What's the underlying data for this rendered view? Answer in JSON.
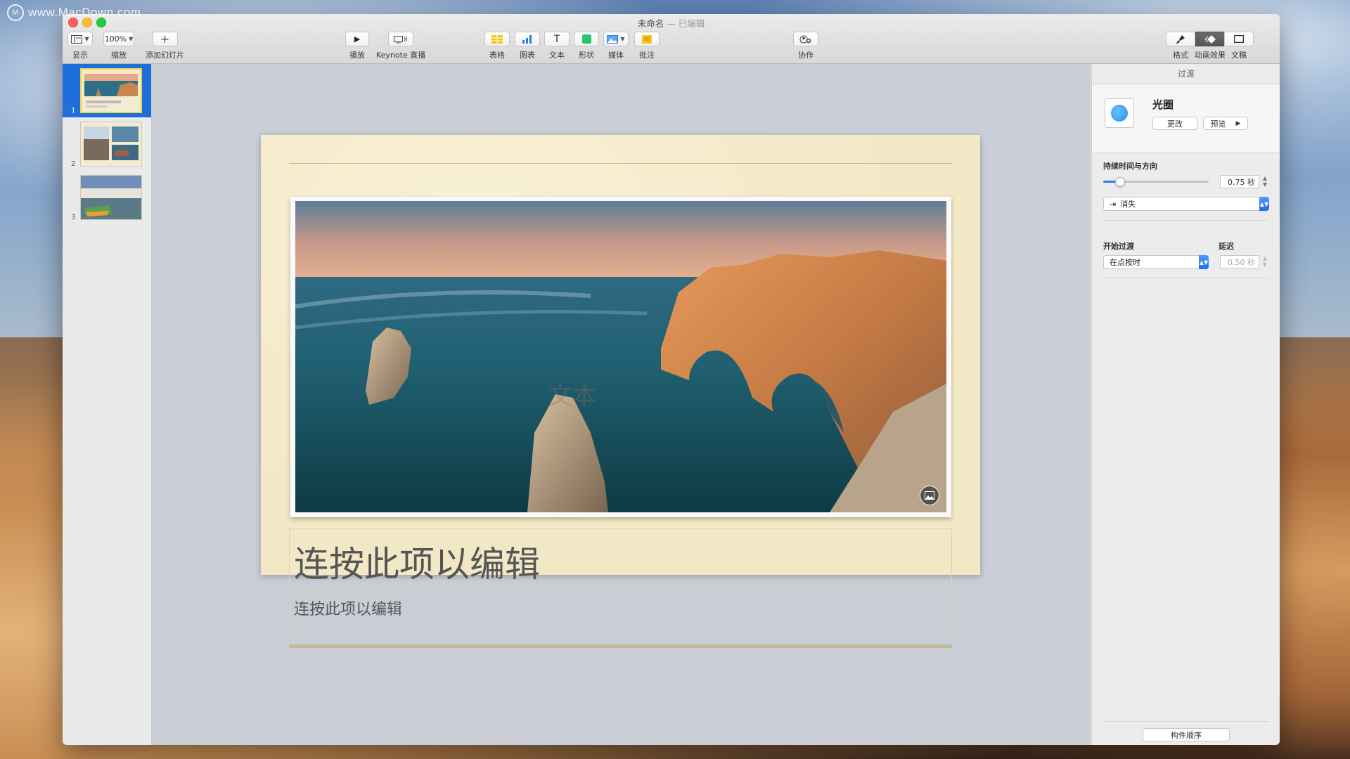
{
  "desktop": {
    "watermark": "www.MacDown.com",
    "watermark_logo": "M"
  },
  "window": {
    "doc_title": "未命名",
    "doc_status": "— 已编辑"
  },
  "toolbar": {
    "view_label": "显示",
    "zoom_value": "100%",
    "zoom_label": "缩放",
    "add_slide_label": "添加幻灯片",
    "play_label": "播放",
    "keynote_live_label": "Keynote 直播",
    "table_label": "表格",
    "chart_label": "图表",
    "text_label": "文本",
    "shape_label": "形状",
    "media_label": "媒体",
    "comment_label": "批注",
    "collaborate_label": "协作",
    "format_label": "格式",
    "animate_label": "动画效果",
    "document_label": "文稿"
  },
  "slides": [
    {
      "number": "1"
    },
    {
      "number": "2"
    },
    {
      "number": "3"
    }
  ],
  "slide": {
    "ghost_text": "文本",
    "title": "连按此项以编辑",
    "subtitle": "连按此项以编辑"
  },
  "inspector": {
    "header": "过渡",
    "transition_name": "光圈",
    "change_button": "更改",
    "preview_button": "预览",
    "duration_section": "持续时间与方向",
    "duration_value": "0.75 秒",
    "duration_fraction": 0.15,
    "direction_value": "消失",
    "start_section": "开始过渡",
    "start_value": "在点按时",
    "delay_section": "延迟",
    "delay_value": "0.50 秒",
    "build_order_button": "构件顺序"
  },
  "colors": {
    "accent": "#1e6fdc",
    "slide_paper": "#f3e8c6",
    "canvas_bg": "#c9ced6"
  }
}
